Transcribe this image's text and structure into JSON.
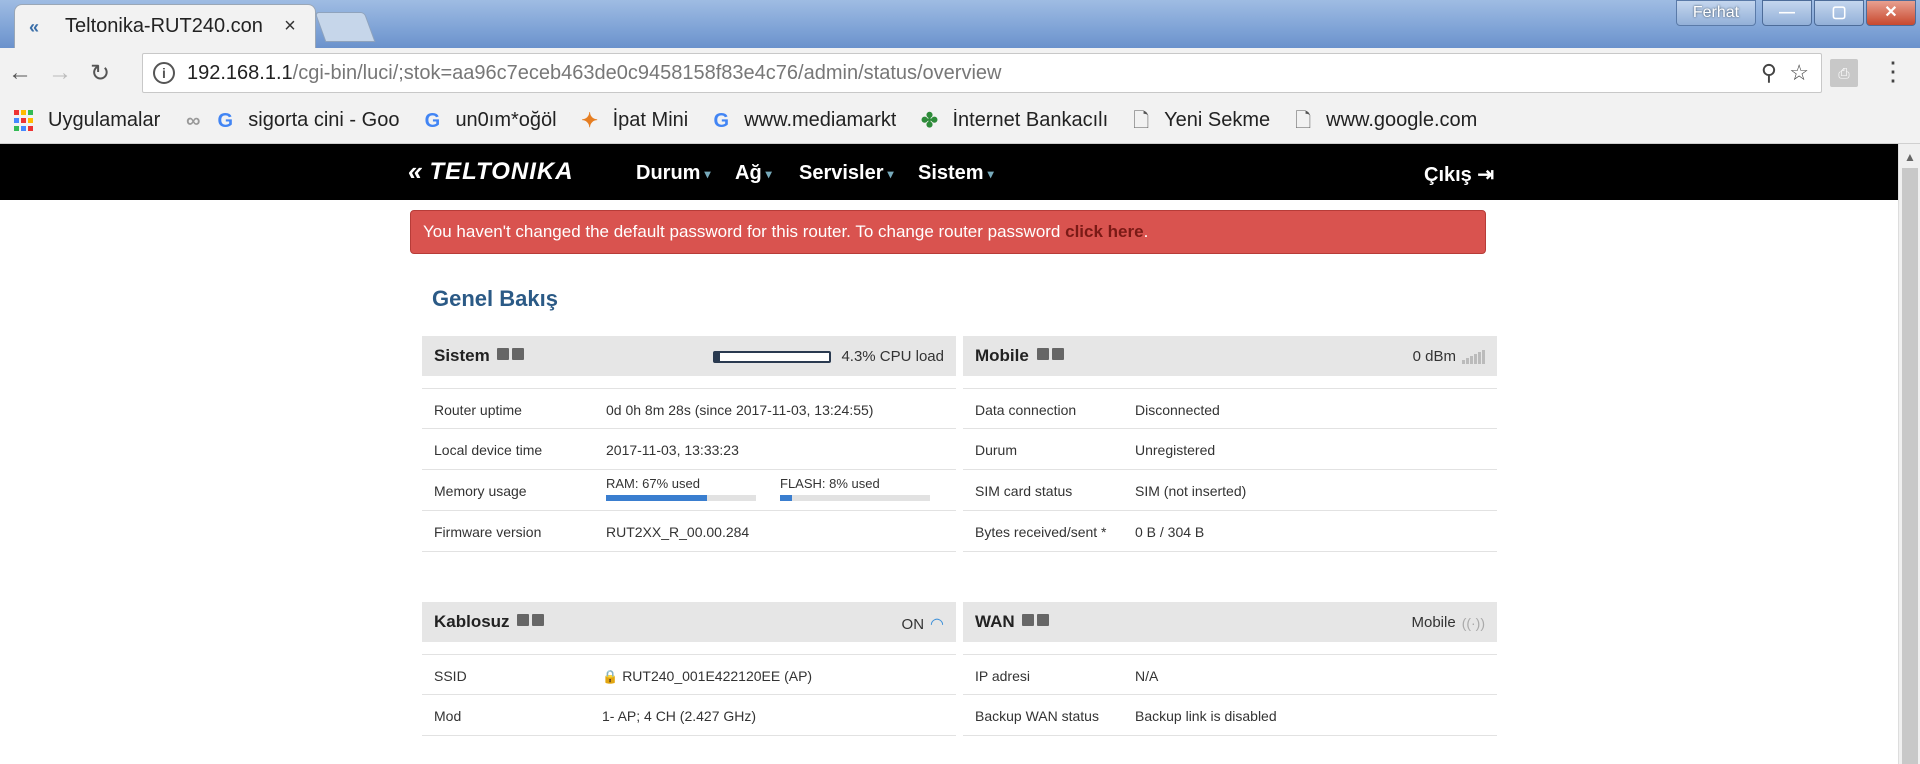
{
  "browser": {
    "tab_title": "Teltonika-RUT240.con",
    "tab_close": "×",
    "window_user": "Ferhat",
    "url_host": "192.168.1.1",
    "url_path": "/cgi-bin/luci/;stok=aa96c7eceb463de0c9458158f83e4c76/admin/status/overview",
    "bookmarks": [
      {
        "label": "Uygulamalar",
        "icon": "apps-icon"
      },
      {
        "label": "sigorta cini - Goo",
        "icon": "google-icon"
      },
      {
        "label": "un0ım*oğöl",
        "icon": "google-icon"
      },
      {
        "label": "İpat Mini",
        "icon": "pinwheel-icon"
      },
      {
        "label": "www.mediamarkt",
        "icon": "google-icon"
      },
      {
        "label": "İnternet Bankacılı",
        "icon": "clover-icon"
      },
      {
        "label": "Yeni Sekme",
        "icon": "page-icon"
      },
      {
        "label": "www.google.com",
        "icon": "page-icon"
      }
    ]
  },
  "nav": {
    "logo": "TELTONIKA",
    "items": [
      "Durum",
      "Ağ",
      "Servisler",
      "Sistem"
    ],
    "logout": "Çıkış"
  },
  "alert": {
    "text": "You haven't changed the default password for this router. To change router password ",
    "link": "click here",
    "suffix": "."
  },
  "page_title": "Genel Bakış",
  "panels": {
    "sistem": {
      "title": "Sistem",
      "cpu_load": 4.3,
      "cpu_label": "4.3% CPU load",
      "rows": [
        {
          "label": "Router uptime",
          "value": "0d 0h 8m 28s (since 2017-11-03, 13:24:55)"
        },
        {
          "label": "Local device time",
          "value": "2017-11-03, 13:33:23"
        },
        {
          "label": "Memory usage",
          "value": ""
        },
        {
          "label": "Firmware version",
          "value": "RUT2XX_R_00.00.284"
        }
      ],
      "memory": {
        "ram_label": "RAM: 67% used",
        "ram": 67,
        "flash_label": "FLASH: 8% used",
        "flash": 8
      }
    },
    "mobile": {
      "title": "Mobile",
      "signal": "0 dBm",
      "rows": [
        {
          "label": "Data connection",
          "value": "Disconnected"
        },
        {
          "label": "Durum",
          "value": "Unregistered"
        },
        {
          "label": "SIM card status",
          "value": "SIM (not inserted)"
        },
        {
          "label": "Bytes received/sent *",
          "value": "0 B / 304 B"
        }
      ]
    },
    "kablosuz": {
      "title": "Kablosuz",
      "status": "ON",
      "rows": [
        {
          "label": "SSID",
          "value": "RUT240_001E422120EE (AP)"
        },
        {
          "label": "Mod",
          "value": "1- AP; 4 CH (2.427 GHz)"
        }
      ]
    },
    "wan": {
      "title": "WAN",
      "status": "Mobile",
      "rows": [
        {
          "label": "IP adresi",
          "value": "N/A"
        },
        {
          "label": "Backup WAN status",
          "value": "Backup link is disabled"
        }
      ]
    }
  },
  "colors": {
    "accent": "#2b5a86",
    "alert": "#d9534f",
    "bar": "#3a7ecf"
  }
}
